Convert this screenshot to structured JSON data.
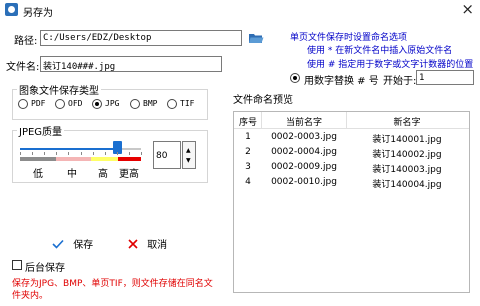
{
  "window": {
    "title": "另存为",
    "close_glyph": "×"
  },
  "path": {
    "label": "路径:",
    "value": "C:/Users/EDZ/Desktop"
  },
  "filename": {
    "label": "文件名:",
    "value": "装订140###.jpg"
  },
  "hints": {
    "line1": "单页文件保存时设置命名选项",
    "line2": "使用 * 在新文件名中插入原始文件名",
    "line3": "使用 # 指定用于数字或文字计数器的位置"
  },
  "numbering": {
    "label": "用数字替换 # 号",
    "start_label": "开始于:",
    "start_value": "1",
    "selected": true
  },
  "format_group": {
    "legend": "图象文件保存类型",
    "options": [
      "PDF",
      "OFD",
      "JPG",
      "BMP",
      "TIF"
    ],
    "selected": "JPG"
  },
  "quality_group": {
    "legend": "JPEG质量",
    "value": "80",
    "slider_fraction": 0.8,
    "level_labels": [
      "低",
      "中",
      "高",
      "更高"
    ],
    "level_colors": [
      "#8c8c8c",
      "#f4b5b5",
      "#ffff66",
      "#e60000"
    ]
  },
  "preview": {
    "title": "文件命名预览",
    "columns": [
      "序号",
      "当前名字",
      "新名字"
    ],
    "rows": [
      [
        "1",
        "0002-0003.jpg",
        "装订140001.jpg"
      ],
      [
        "2",
        "0002-0004.jpg",
        "装订140002.jpg"
      ],
      [
        "3",
        "0002-0009.jpg",
        "装订140003.jpg"
      ],
      [
        "4",
        "0002-0010.jpg",
        "装订140004.jpg"
      ]
    ]
  },
  "actions": {
    "save_label": "保存",
    "cancel_label": "取消",
    "save_icon": "check-icon",
    "cancel_icon": "cross-icon"
  },
  "background_save": {
    "label": "后台保存",
    "checked": false
  },
  "note": "保存为JPG、BMP、单页TIF，则文件存储在同名文件夹内。",
  "colors": {
    "hint_blue": "#0000c8",
    "note_red": "#e00000",
    "accent_blue": "#1a6fd0"
  }
}
